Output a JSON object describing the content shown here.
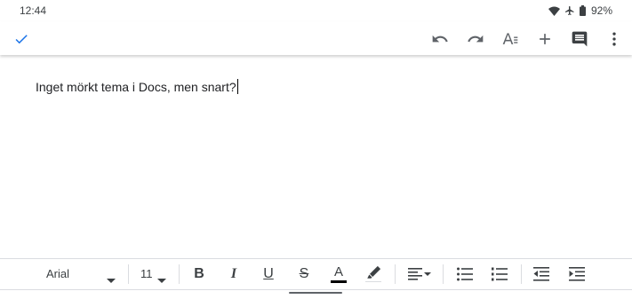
{
  "status_bar": {
    "time": "12:44",
    "battery": "92%",
    "icons": [
      "wifi-icon",
      "airplane-icon",
      "battery-icon"
    ]
  },
  "toolbar": {
    "done_icon": "check-icon",
    "actions": [
      "undo-icon",
      "redo-icon",
      "text-format-icon",
      "add-icon",
      "comment-icon",
      "more-vert-icon"
    ],
    "accent_color": "#1a73e8"
  },
  "document": {
    "text": "Inget mörkt tema i Docs, men snart?"
  },
  "format_bar": {
    "font": "Arial",
    "size": "11",
    "bold": "B",
    "italic": "I",
    "underline": "U",
    "strikethrough": "S",
    "text_color_letter": "A",
    "icons": [
      "highlight-icon",
      "align-left-icon",
      "bulleted-list-icon",
      "numbered-list-icon",
      "decrease-indent-icon",
      "increase-indent-icon"
    ]
  }
}
